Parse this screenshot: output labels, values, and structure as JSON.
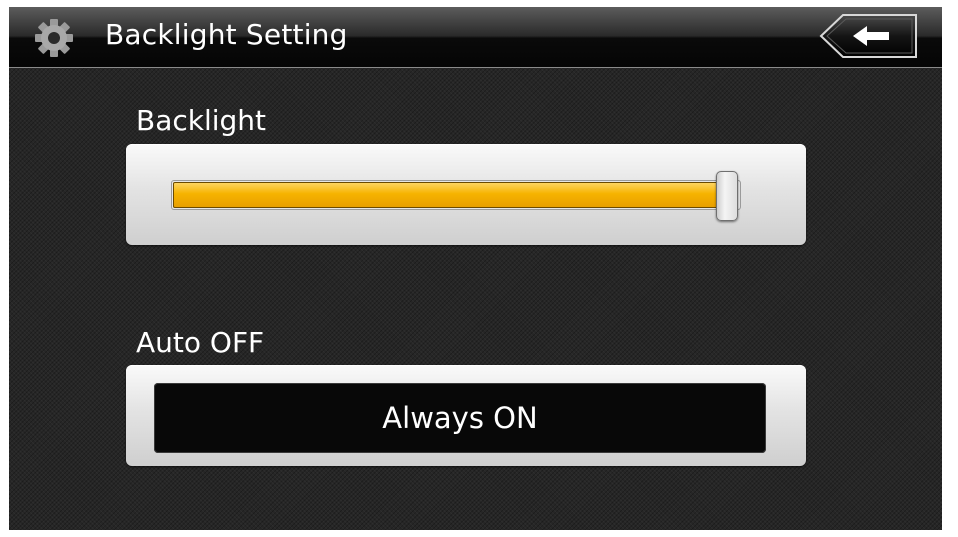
{
  "header": {
    "title": "Backlight Setting",
    "settings_icon": "gear-icon",
    "back_icon": "back-arrow-icon"
  },
  "backlight": {
    "label": "Backlight",
    "level_percent": 100
  },
  "auto_off": {
    "label": "Auto OFF",
    "value": "Always ON"
  },
  "colors": {
    "slider_fill": "#f6b300",
    "background": "#262626"
  }
}
